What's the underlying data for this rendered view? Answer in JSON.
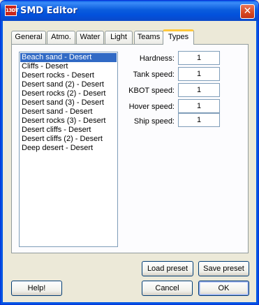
{
  "window": {
    "title": "SMD Editor",
    "icon_text": "13DT",
    "close_glyph": "✕"
  },
  "tabs": [
    {
      "label": "General",
      "active": false
    },
    {
      "label": "Atmo.",
      "active": false
    },
    {
      "label": "Water",
      "active": false
    },
    {
      "label": "Light",
      "active": false
    },
    {
      "label": "Teams",
      "active": false
    },
    {
      "label": "Types",
      "active": true
    }
  ],
  "types_list": {
    "selected_index": 0,
    "items": [
      "Beach sand - Desert",
      "Cliffs - Desert",
      "Desert rocks - Desert",
      "Desert sand (2) - Desert",
      "Desert rocks (2) - Desert",
      "Desert sand (3) - Desert",
      "Desert sand - Desert",
      "Desert rocks (3) - Desert",
      "Desert cliffs - Desert",
      "Desert cliffs (2) - Desert",
      "Deep desert - Desert"
    ]
  },
  "fields": [
    {
      "label": "Hardness:",
      "value": "1"
    },
    {
      "label": "Tank speed:",
      "value": "1"
    },
    {
      "label": "KBOT speed:",
      "value": "1"
    },
    {
      "label": "Hover speed:",
      "value": "1"
    },
    {
      "label": "Ship speed:",
      "value": "1"
    }
  ],
  "buttons": {
    "load_preset": "Load preset",
    "save_preset": "Save preset",
    "help": "Help!",
    "cancel": "Cancel",
    "ok": "OK"
  },
  "colors": {
    "title_bar": "#0a5ee7",
    "active_tab_accent": "#ffc83c",
    "selection": "#316ac5",
    "close_button": "#d6461f"
  }
}
